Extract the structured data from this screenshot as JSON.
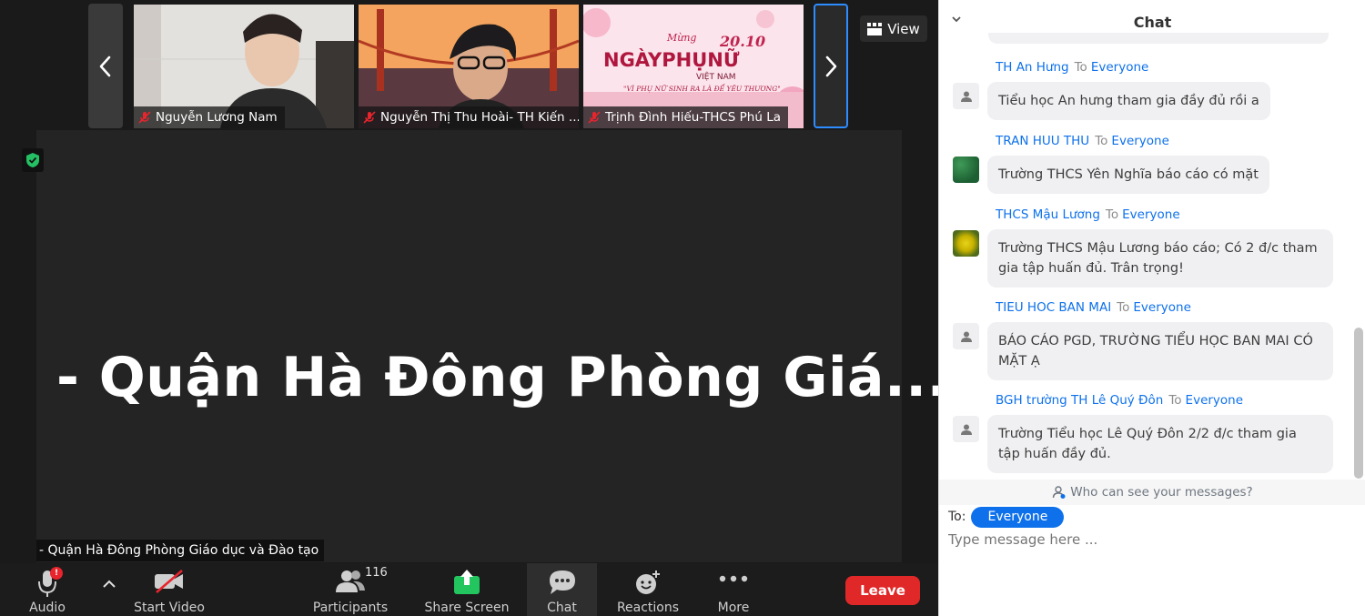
{
  "participants_strip": [
    {
      "name": "Nguyễn Lương Nam"
    },
    {
      "name": "Nguyễn Thị Thu Hoài- TH Kiến ..."
    },
    {
      "name": "Trịnh Đình Hiếu-THCS Phú La"
    }
  ],
  "thumb3_banner": {
    "top": "20.10",
    "script": "Mừng",
    "main": "NGÀYPHỤNỮ",
    "sub": "VIỆT NAM",
    "slogan": "\"VÌ PHỤ NỮ SINH RA LÀ ĐỂ YÊU THƯƠNG\""
  },
  "view_button": {
    "label": "View",
    "icon": "grid-icon"
  },
  "main_speaker": {
    "big_name": "- Quận Hà Đông Phòng Giá...",
    "label": "- Quận Hà Đông Phòng Giáo dục và Đào tạo"
  },
  "toolbar": {
    "audio": {
      "label": "Audio",
      "badge": "!"
    },
    "video": {
      "label": "Start Video"
    },
    "participants": {
      "label": "Participants",
      "count": "116"
    },
    "share": {
      "label": "Share Screen"
    },
    "chat": {
      "label": "Chat"
    },
    "reactions": {
      "label": "Reactions"
    },
    "more": {
      "label": "More"
    },
    "leave": {
      "label": "Leave"
    }
  },
  "chat": {
    "title": "Chat",
    "to_word": "To",
    "messages": [
      {
        "from": "TH An Hưng",
        "to": "Everyone",
        "text": "Tiểu học An hưng tham gia đầy đủ rồi a",
        "avatar": "default"
      },
      {
        "from": "TRAN HUU THU",
        "to": "Everyone",
        "text": "Trường THCS Yên Nghĩa báo cáo có mặt",
        "avatar": "green"
      },
      {
        "from": "THCS Mậu Lương",
        "to": "Everyone",
        "text": "Trường THCS Mậu Lương báo cáo; Có 2 đ/c tham gia tập huấn đủ. Trân trọng!",
        "avatar": "flower"
      },
      {
        "from": "TIEU HOC BAN MAI",
        "to": "Everyone",
        "text": "BÁO CÁO PGD, TRƯỜNG TIỂU HỌC BAN MAI CÓ MẶT Ạ",
        "avatar": "default"
      },
      {
        "from": "BGH trường TH Lê Quý Đôn",
        "to": "Everyone",
        "text": "Trường Tiểu học Lê Quý Đôn 2/2 đ/c tham gia tập huấn đầy đủ.",
        "avatar": "default"
      }
    ],
    "who_can_see": "Who can see your messages?",
    "to_label": "To:",
    "recipient": "Everyone",
    "input_placeholder": "Type message here ..."
  },
  "colors": {
    "accent": "#0e71eb",
    "leave": "#e02828",
    "share_green": "#22c55e"
  }
}
